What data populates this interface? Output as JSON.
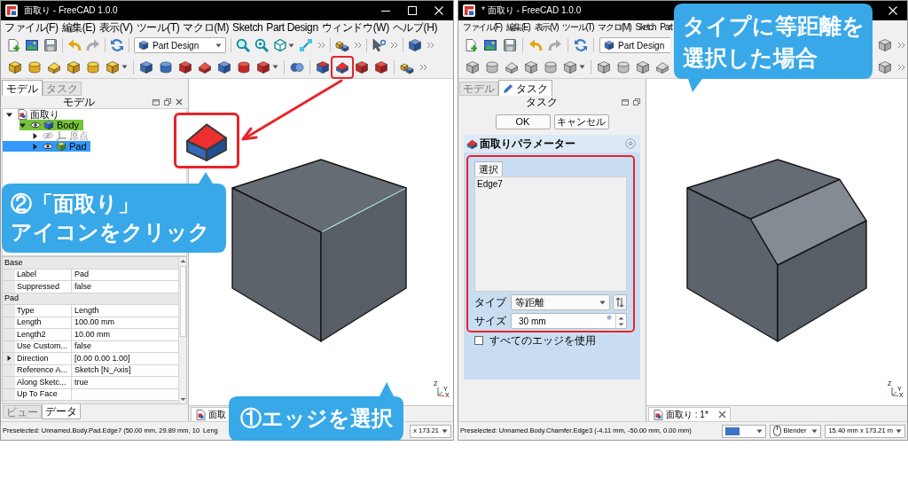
{
  "windows": [
    {
      "title": "面取り - FreeCAD 1.0.0",
      "title_buttons": [
        {
          "kind": "minimize"
        },
        {
          "kind": "maximize"
        },
        {
          "kind": "close"
        }
      ],
      "menu": [
        "ファイル(F)",
        "編集(E)",
        "表示(V)",
        "ツール(T)",
        "マクロ(M)",
        "Sketch",
        "Part Design",
        "ウィンドウ(W)",
        "ヘルプ(H)"
      ],
      "workbench": "Part Design",
      "feature_toolbar": {
        "disabled": false
      },
      "panel_tabs": [
        {
          "label": "モデル",
          "selected": true
        },
        {
          "label": "タスク",
          "selected": false
        }
      ],
      "panel_title": "モデル",
      "panel_buttons": [
        {
          "kind": "float"
        },
        {
          "kind": "undock"
        },
        {
          "kind": "close"
        }
      ],
      "tree": [
        {
          "label": "面取り",
          "kind": "document",
          "expanded": true,
          "selected": false,
          "active": false,
          "children": [
            {
              "label": "Body",
              "kind": "body",
              "expanded": true,
              "selected": false,
              "active": true,
              "visible": true,
              "children": [
                {
                  "label": "原点",
                  "kind": "origin",
                  "expanded": false,
                  "selected": false,
                  "active": false,
                  "visible": false
                },
                {
                  "label": "Pad",
                  "kind": "feature",
                  "expanded": false,
                  "selected": true,
                  "active": false,
                  "visible": true
                }
              ]
            }
          ]
        }
      ],
      "properties": [
        {
          "kind": "group",
          "name": "Base"
        },
        {
          "kind": "property",
          "name": "Label",
          "value": "Pad"
        },
        {
          "kind": "property",
          "name": "Suppressed",
          "value": "false"
        },
        {
          "kind": "group",
          "name": "Pad"
        },
        {
          "kind": "property",
          "name": "Type",
          "value": "Length"
        },
        {
          "kind": "property",
          "name": "Length",
          "value": "100.00 mm"
        },
        {
          "kind": "property",
          "name": "Length2",
          "value": "10.00 mm"
        },
        {
          "kind": "property",
          "name": "Use Custom...",
          "value": "false"
        },
        {
          "kind": "property",
          "name": "Direction",
          "value": "[0.00 0.00 1.00]",
          "expanded": false
        },
        {
          "kind": "property",
          "name": "Reference A...",
          "value": "Sketch [N_Axis]"
        },
        {
          "kind": "property",
          "name": "Along Sketc...",
          "value": "true"
        },
        {
          "kind": "property",
          "name": "Up To Face"
        }
      ],
      "property_tabs": [
        {
          "label": "ビュー",
          "selected": false
        },
        {
          "label": "データ",
          "selected": true
        }
      ],
      "viewport": {
        "kind": "box",
        "edge_highlighted": true,
        "axes": [
          "Z",
          "Y",
          "X"
        ]
      },
      "document_tabs": [
        {
          "label": "面取",
          "closable": false
        }
      ],
      "status": "Preselected: Unnamed.Body.Pad.Edge7 (50.00 mm, 29.89 mm, 10",
      "status_fields": [
        {
          "kind": "text",
          "text": "Leng"
        },
        {
          "kind": "dropdown",
          "text": "x 173.21"
        }
      ]
    },
    {
      "title": "* 面取り - FreeCAD 1.0.0",
      "title_buttons": [
        {
          "kind": "close"
        }
      ],
      "menu": [
        "ファイル(F)",
        "編集(E)",
        "表示(V)",
        "ツール(T)",
        "マクロ(M)",
        "Sketch",
        "Part"
      ],
      "workbench": "Part Design",
      "feature_toolbar": {
        "disabled": true
      },
      "panel_tabs": [
        {
          "label": "モデル",
          "selected": false
        },
        {
          "label": "タスク",
          "selected": true
        }
      ],
      "panel_title": "タスク",
      "panel_buttons": [
        {
          "kind": "float"
        },
        {
          "kind": "undock"
        }
      ],
      "task": {
        "buttons": [
          "OK",
          "キャンセル"
        ],
        "section_title": "面取りパラメーター",
        "section_expanded": true,
        "select_button": "選択",
        "references": [
          "Edge7"
        ],
        "fields": [
          {
            "kind": "dropdown",
            "label": "タイプ",
            "value": "等距離"
          },
          {
            "kind": "spinbox",
            "label": "サイズ",
            "value": "30 mm"
          }
        ],
        "use_all_edges": {
          "label": "すべてのエッジを使用",
          "checked": false
        }
      },
      "viewport": {
        "kind": "chamfered-box",
        "axes": [
          "Z",
          "Y",
          "X"
        ]
      },
      "document_tabs": [
        {
          "label": "面取り : 1*",
          "closable": true
        }
      ],
      "status": "Preselected: Unnamed.Body.Chamfer.Edge3 (-4.11 mm, -50.00 mm, 0.00 mm)",
      "status_fields": [
        {
          "kind": "swatch"
        },
        {
          "kind": "navigation",
          "text": "Blender"
        },
        {
          "kind": "dropdown",
          "text": "15.40 mm x 173.21 m"
        }
      ]
    }
  ],
  "callouts": [
    {
      "lines": [
        "②「面取り」",
        "アイコンをクリック"
      ]
    },
    {
      "lines": [
        "①エッジを選択"
      ]
    },
    {
      "lines": [
        "タイプに等距離を",
        "選択した場合"
      ]
    }
  ]
}
